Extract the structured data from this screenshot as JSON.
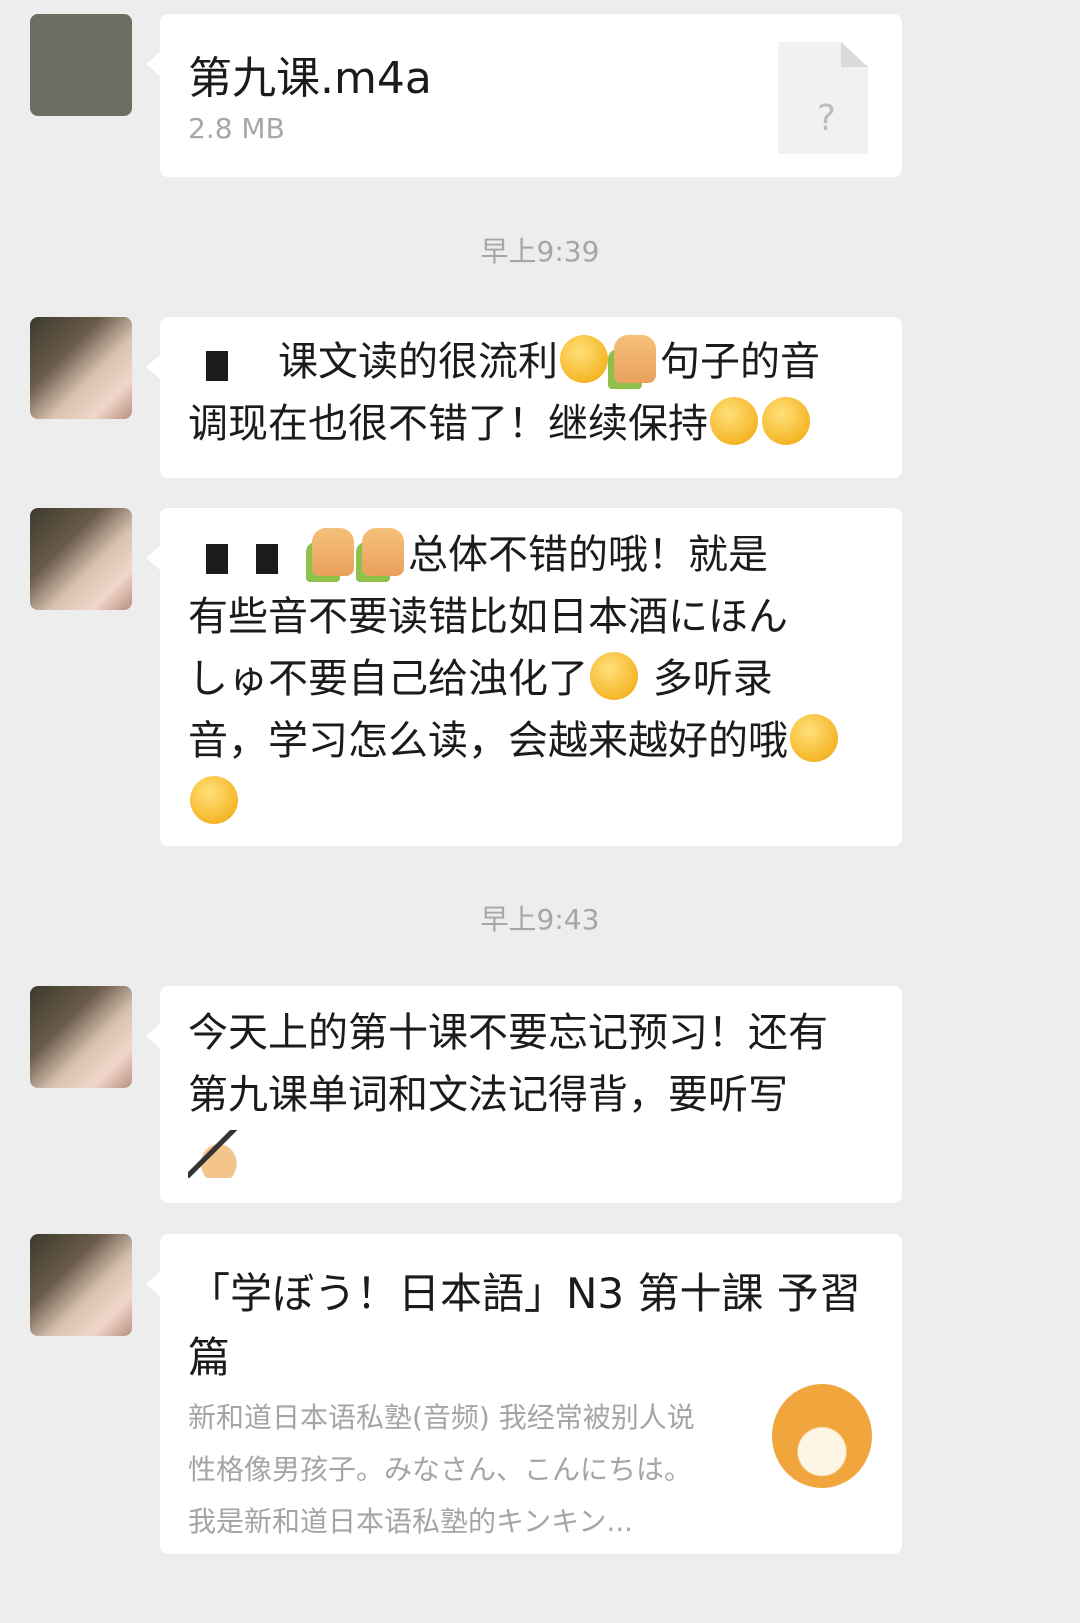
{
  "messages": [
    {
      "type": "file",
      "file_name": "第九课.m4a",
      "file_size": "2.8 MB",
      "file_icon": "?"
    },
    {
      "type": "timestamp",
      "text": "早上9:39"
    },
    {
      "type": "text",
      "line1_tail": "课文读的很流利",
      "line1_end": "句子的音",
      "line2": "调现在也很不错了！继续保持"
    },
    {
      "type": "text",
      "line1_tail": "总体不错的哦！就是",
      "line2": "有些音不要读错比如日本酒にほん",
      "line3": "しゅ不要自己给浊化了",
      "line3_end": " 多听录",
      "line4": "音，学习怎么读，会越来越好的哦"
    },
    {
      "type": "timestamp",
      "text": "早上9:43"
    },
    {
      "type": "text",
      "line1": "今天上的第十课不要忘记预习！还有",
      "line2": "第九课单词和文法记得背，要听写"
    },
    {
      "type": "link",
      "title": "「学ぼう！日本語」N3 第十課 予習篇",
      "desc": "新和道日本语私塾(音频) 我经常被别人说性格像男孩子。みなさん、こんにちは。我是新和道日本语私塾的キンキン..."
    }
  ],
  "icons": {
    "avatar1": "avatar-cartoon",
    "avatar2": "avatar-photo",
    "file": "document-icon",
    "emoji_hug": "hug-emoji-icon",
    "emoji_thumb": "thumbs-up-icon",
    "emoji_determined": "determined-face-icon",
    "emoji_smile": "smile-icon",
    "emoji_writing": "writing-hand-icon",
    "link_thumb": "shiba-dog-icon"
  }
}
